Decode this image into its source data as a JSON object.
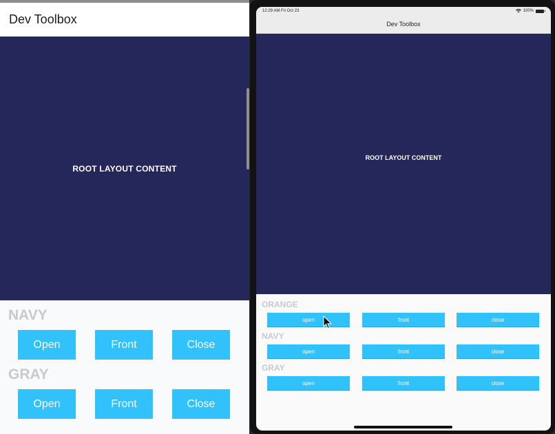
{
  "android": {
    "app_title": "Dev Toolbox",
    "root_label": "ROOT LAYOUT CONTENT",
    "sections": [
      {
        "label": "NAVY",
        "buttons": [
          "Open",
          "Front",
          "Close"
        ]
      },
      {
        "label": "GRAY",
        "buttons": [
          "Open",
          "Front",
          "Close"
        ]
      }
    ]
  },
  "ipad": {
    "status": {
      "time": "12:29 AM  Fri Oct 23",
      "battery": "100%"
    },
    "nav_title": "Dev Toolbox",
    "root_label": "ROOT LAYOUT CONTENT",
    "sections": [
      {
        "label": "ORANGE",
        "buttons": [
          "open",
          "front",
          "close"
        ]
      },
      {
        "label": "NAVY",
        "buttons": [
          "open",
          "front",
          "close"
        ]
      },
      {
        "label": "GRAY",
        "buttons": [
          "open",
          "front",
          "close"
        ]
      }
    ]
  },
  "colors": {
    "navy": "#252659",
    "button": "#31c1fb",
    "section_label": "#c7c9cc"
  }
}
